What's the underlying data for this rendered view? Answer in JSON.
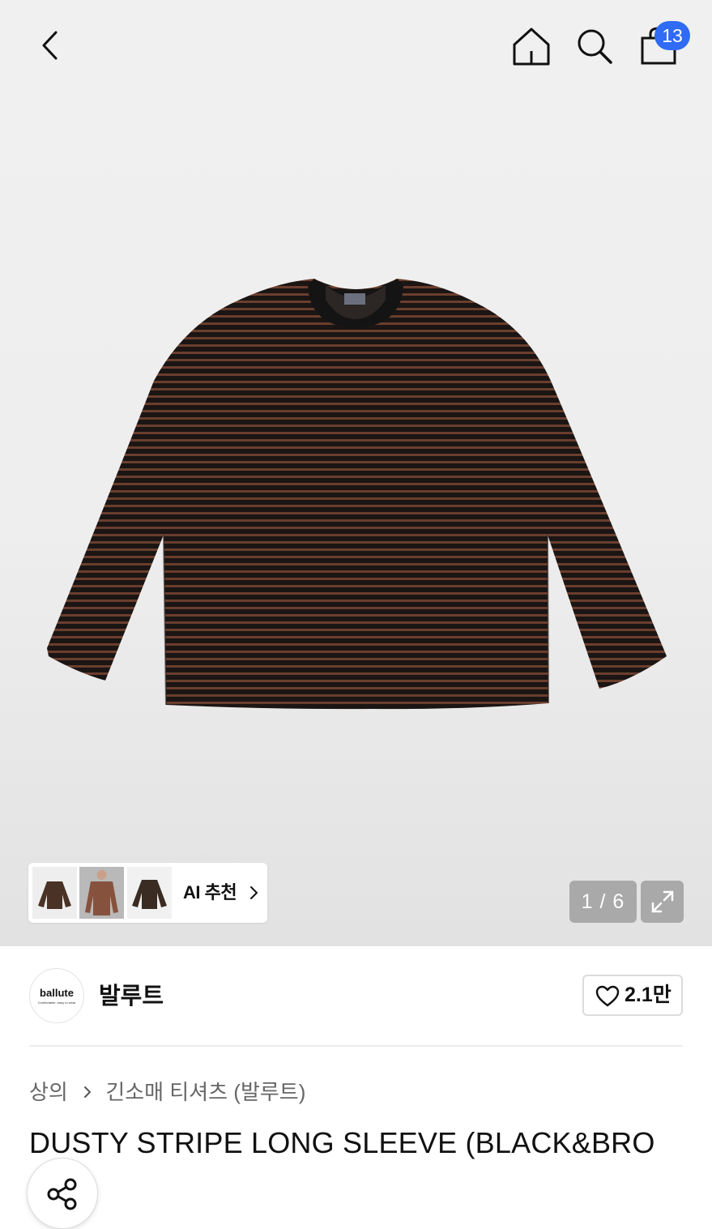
{
  "header": {
    "cart_count": "13",
    "icons": [
      "chevron-left-icon",
      "home-icon",
      "search-icon",
      "shopping-bag-icon"
    ]
  },
  "gallery": {
    "ai_recommend_label": "AI 추천",
    "pager": "1 / 6"
  },
  "brand": {
    "logo_text": "ballute",
    "logo_tagline": "Comfortable, easy to wear",
    "name": "발루트",
    "like_count": "2.1만"
  },
  "breadcrumb": {
    "items": [
      "상의",
      "긴소매 티셔츠 (발루트)"
    ]
  },
  "product": {
    "title": "DUSTY STRIPE LONG SLEEVE (BLACK&BRO"
  },
  "colors": {
    "badge": "#2f6bf4",
    "stripe_dark": "#1b1514",
    "stripe_brown": "#6a3e2d"
  }
}
